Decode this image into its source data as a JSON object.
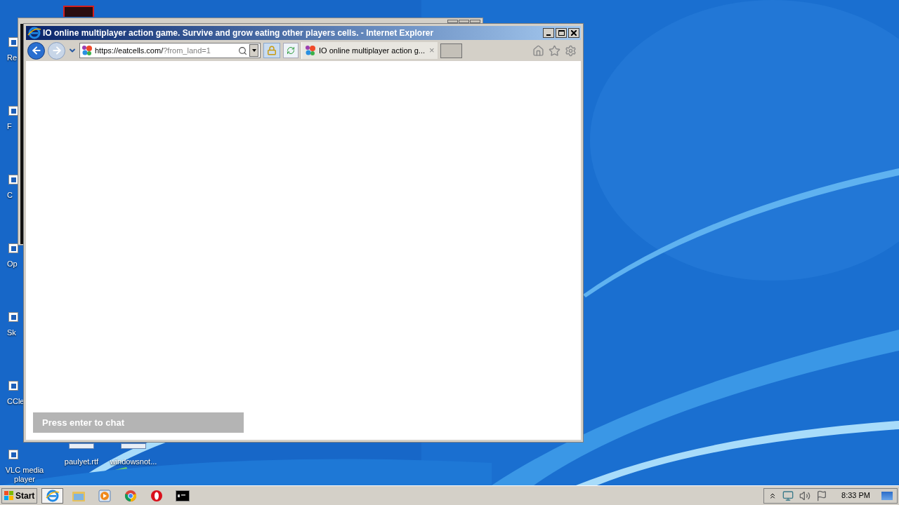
{
  "desktop_icons": [
    {
      "label": "Re"
    },
    {
      "label": "F"
    },
    {
      "label": "C"
    },
    {
      "label": "Op"
    },
    {
      "label": "Sk"
    },
    {
      "label": "CCle"
    },
    {
      "label": "VLC media player"
    }
  ],
  "desktop_files": [
    {
      "label": "paulyet.rtf"
    },
    {
      "label": "windowsnot..."
    }
  ],
  "browser": {
    "title": "IO online multiplayer action game. Survive and grow eating other players cells. - Internet Explorer",
    "address_host": "https://eatcells.com/",
    "address_path": "?from_land=1",
    "tabs": [
      {
        "title": "IO online multiplayer action g...",
        "close": "×"
      }
    ],
    "chat": {
      "placeholder": "Press enter to chat"
    }
  },
  "taskbar": {
    "start": "Start",
    "apps": [
      {
        "kind": "ie",
        "selected": true
      },
      {
        "kind": "folder",
        "selected": false
      },
      {
        "kind": "media",
        "selected": false
      },
      {
        "kind": "chrome",
        "selected": false
      },
      {
        "kind": "opera",
        "selected": false
      },
      {
        "kind": "cmd",
        "selected": false
      }
    ],
    "clock": "8:33 PM"
  }
}
